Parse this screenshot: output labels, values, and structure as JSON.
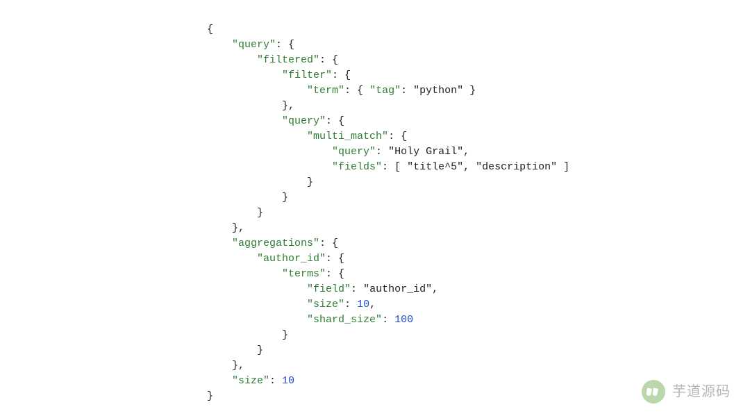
{
  "code": {
    "line1": "{",
    "line2_key": "\"query\"",
    "line2_rest": ": {",
    "line3_key": "\"filtered\"",
    "line3_rest": ": {",
    "line4_key": "\"filter\"",
    "line4_rest": ": {",
    "line5_key_term": "\"term\"",
    "line5_mid": ": { ",
    "line5_key_tag": "\"tag\"",
    "line5_colon": ": ",
    "line5_val": "\"python\"",
    "line5_end": " }",
    "line6": "},",
    "line7_key": "\"query\"",
    "line7_rest": ": {",
    "line8_key": "\"multi_match\"",
    "line8_rest": ": {",
    "line9_key": "\"query\"",
    "line9_colon": ": ",
    "line9_val": "\"Holy Grail\"",
    "line9_comma": ",",
    "line10_key": "\"fields\"",
    "line10_colon": ": [ ",
    "line10_val1": "\"title^5\"",
    "line10_sep": ", ",
    "line10_val2": "\"description\"",
    "line10_end": " ]",
    "line11": "}",
    "line12": "}",
    "line13": "}",
    "line14": "},",
    "line15_key": "\"aggregations\"",
    "line15_rest": ": {",
    "line16_key": "\"author_id\"",
    "line16_rest": ": {",
    "line17_key": "\"terms\"",
    "line17_rest": ": {",
    "line18_key": "\"field\"",
    "line18_colon": ": ",
    "line18_val": "\"author_id\"",
    "line18_comma": ",",
    "line19_key": "\"size\"",
    "line19_colon": ": ",
    "line19_val": "10",
    "line19_comma": ",",
    "line20_key": "\"shard_size\"",
    "line20_colon": ": ",
    "line20_val": "100",
    "line21": "}",
    "line22": "}",
    "line23": "},",
    "line24_key": "\"size\"",
    "line24_colon": ": ",
    "line24_val": "10",
    "line25": "}"
  },
  "watermark": {
    "text": "芋道源码"
  }
}
